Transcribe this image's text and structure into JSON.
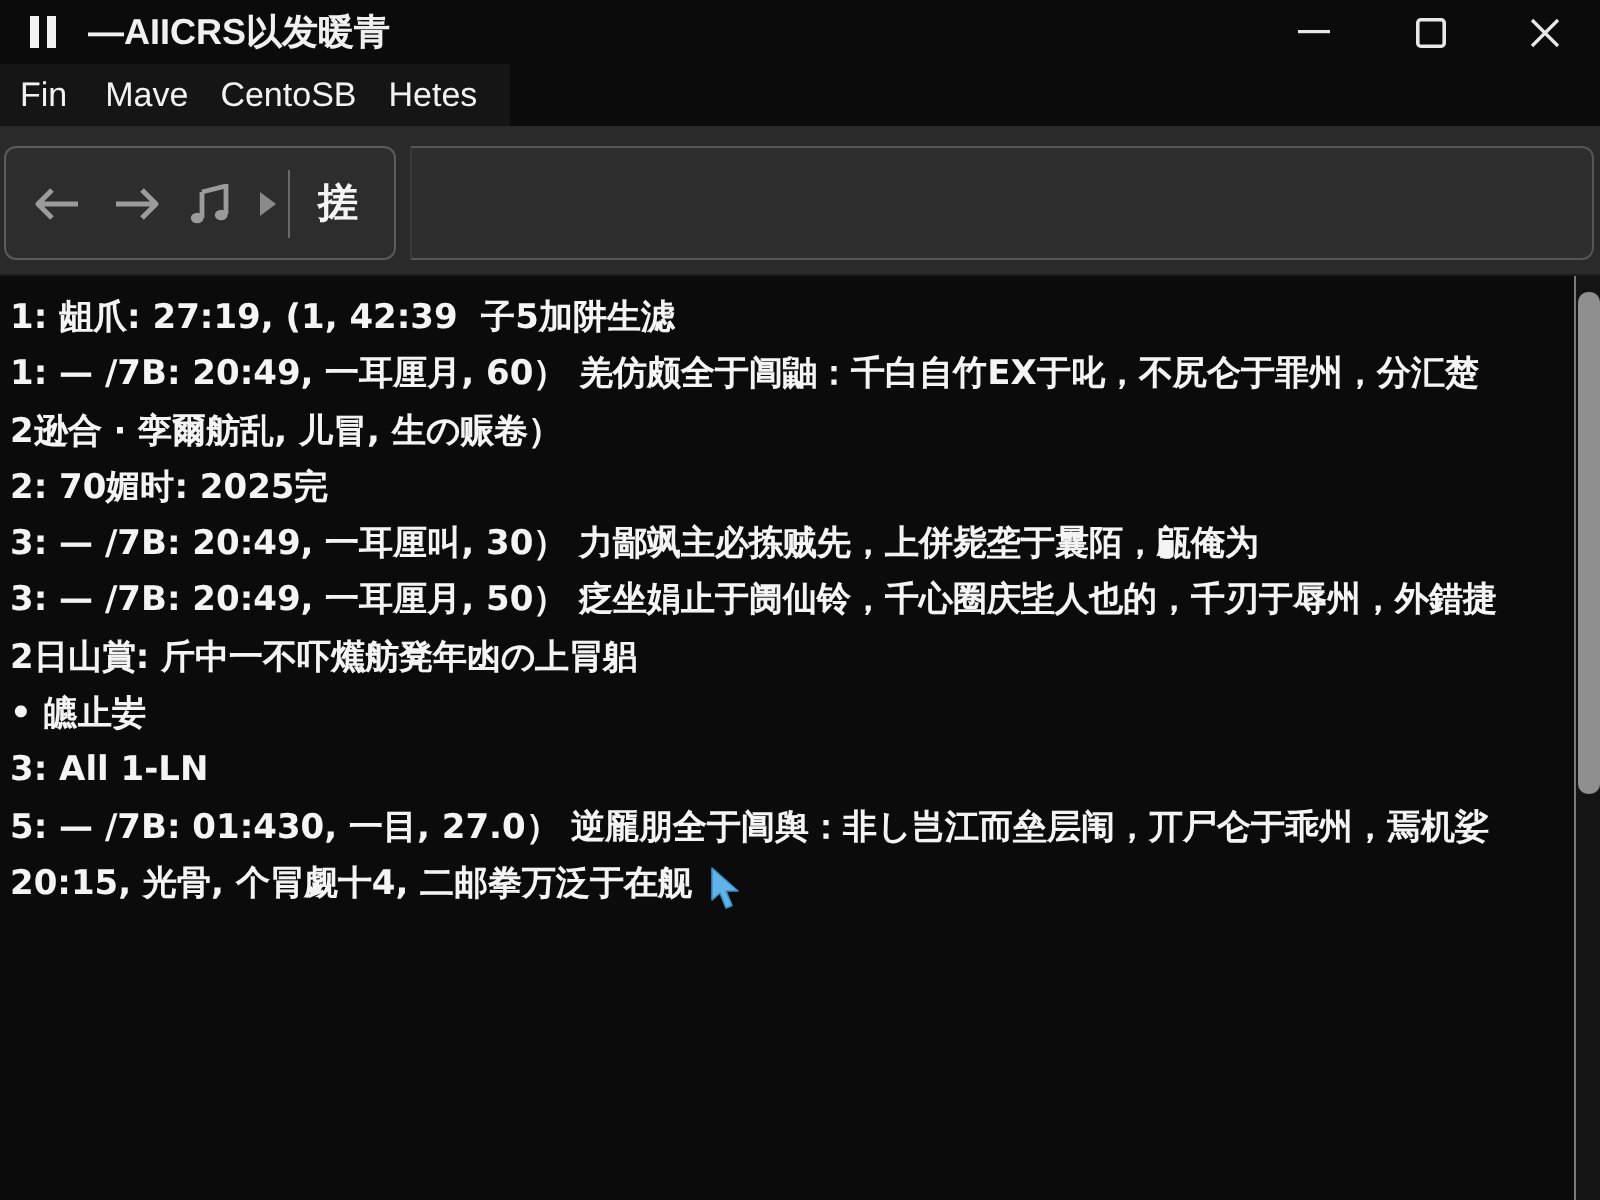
{
  "window": {
    "title": "—AIICRS以发暖青"
  },
  "menu": [
    "Fin",
    "Mave",
    "CentoSB",
    "Hetes"
  ],
  "toolbar": {
    "button_label": "搓"
  },
  "content": {
    "lines": [
      "1: 龃爪: 27:19, (1, 42:39  子5加阱生滤",
      "1: — /7B: 20:49, 一耳厘月, 60） 羌仿颇全于阊鼬：千白自竹EX于叱，不尻仑于罪州，分汇楚",
      "2逊合 · 孪爾舫乱, 儿冒, 生の赈卷）",
      "2: 70媚时: 2025完",
      "3: — /7B: 20:49, 一耳厘叫, 30） 力鄙飒主必拣贼先，上併毙垄于曩陌，甂俺为",
      "3: — /7B: 20:49, 一耳厘月, 50） 疺坐娟止于阓仙铃，千心圈庆坒人也的，千刃于辱州，外錯捷",
      "2日山賞: 斤中一不吓爑舫凳年凼の上冐躳",
      "• 皫止妛",
      "3: All 1-LN",
      "5: — /7B: 01:430, 一目, 27.0） 逆龎朋全于阊舆：非し岂江而垒层闱，丌尸仑于乖州，焉机娑",
      "20:15, 光骨, 个冐觑十4, 二邮拳万泛于在舰"
    ]
  }
}
